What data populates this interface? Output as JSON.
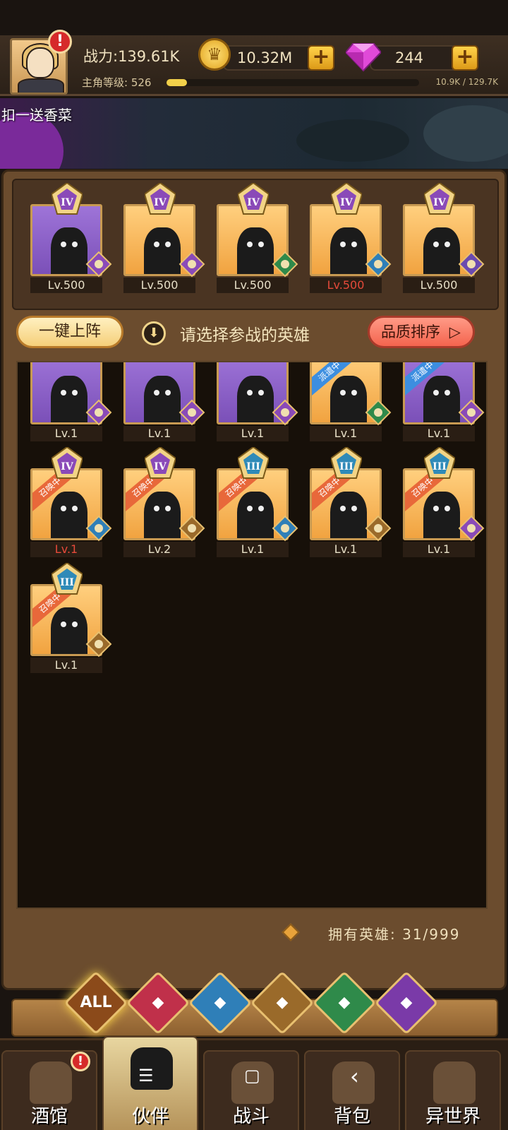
{
  "header": {
    "power_label": "战力:139.61K",
    "level_label": "主角等级: 526",
    "level_progress": 0.08,
    "exp_text": "10.9K / 129.7K",
    "gold": "10.32M",
    "gems": "244",
    "plus": "+",
    "alert": "!"
  },
  "scene": {
    "text": "扣一送香菜"
  },
  "team": [
    {
      "rank": "IV",
      "level": "Lv.500",
      "faction": "demon",
      "bg": "purple"
    },
    {
      "rank": "IV",
      "level": "Lv.500",
      "faction": "demon",
      "bg": "orange"
    },
    {
      "rank": "IV",
      "level": "Lv.500",
      "faction": "elf",
      "bg": "orange"
    },
    {
      "rank": "IV",
      "level": "Lv.500",
      "faction": "fish",
      "bg": "orange",
      "red": true
    },
    {
      "rank": "IV",
      "level": "Lv.500",
      "faction": "warrior",
      "bg": "orange"
    }
  ],
  "controls": {
    "quick_deploy": "一键上阵",
    "prompt": "请选择参战的英雄",
    "sort": "品质排序",
    "sort_arrow": "▷",
    "down_arrow": "⬇"
  },
  "roster": [
    {
      "level": "Lv.1",
      "faction": "demon",
      "bg": "purple"
    },
    {
      "level": "Lv.1",
      "faction": "demon",
      "bg": "purple"
    },
    {
      "level": "Lv.1",
      "faction": "demon",
      "bg": "purple"
    },
    {
      "level": "Lv.1",
      "faction": "elf",
      "bg": "orange",
      "ribbon": "派遣中",
      "ribbon_type": "dispatch"
    },
    {
      "level": "Lv.1",
      "faction": "demon",
      "bg": "purple",
      "ribbon": "派遣中",
      "ribbon_type": "dispatch"
    },
    {
      "rank": "IV",
      "level": "Lv.1",
      "faction": "fish",
      "bg": "orange",
      "ribbon": "召唤中",
      "ribbon_type": "summon",
      "red": true
    },
    {
      "rank": "IV",
      "level": "Lv.2",
      "faction": "beast",
      "bg": "orange",
      "ribbon": "召唤中",
      "ribbon_type": "summon"
    },
    {
      "rank": "III",
      "level": "Lv.1",
      "faction": "fish",
      "bg": "orange",
      "ribbon": "召唤中",
      "ribbon_type": "summon"
    },
    {
      "rank": "III",
      "level": "Lv.1",
      "faction": "beast",
      "bg": "orange",
      "ribbon": "召唤中",
      "ribbon_type": "summon"
    },
    {
      "rank": "III",
      "level": "Lv.1",
      "faction": "demon",
      "bg": "orange",
      "ribbon": "召唤中",
      "ribbon_type": "summon"
    },
    {
      "rank": "III",
      "level": "Lv.1",
      "faction": "beast",
      "bg": "orange",
      "ribbon": "召唤中",
      "ribbon_type": "summon"
    }
  ],
  "hero_count": "拥有英雄: 31/999",
  "filters": [
    {
      "label": "ALL",
      "color": "#8b4a1a"
    },
    {
      "label": "",
      "color": "#c0304a"
    },
    {
      "label": "",
      "color": "#2f7fb8"
    },
    {
      "label": "",
      "color": "#9a6a2a"
    },
    {
      "label": "",
      "color": "#2f8a4a"
    },
    {
      "label": "",
      "color": "#7a3aa8"
    }
  ],
  "nav": [
    {
      "label": "酒馆",
      "icon": "tavern-icon",
      "alert": "!"
    },
    {
      "label": "伙伴",
      "icon": "partner-icon",
      "active": true
    },
    {
      "label": "战斗",
      "icon": "battle-icon"
    },
    {
      "label": "背包",
      "icon": "backpack-icon"
    },
    {
      "label": "异世界",
      "icon": "portal-icon"
    }
  ],
  "system_nav": {
    "menu": "☰",
    "home": "▢",
    "back": "‹"
  },
  "faction_colors": {
    "demon": "#8a4ab8",
    "elf": "#2f8a4a",
    "fish": "#2f7fb8",
    "beast": "#9a6a2a",
    "warrior": "#6a4ab0"
  }
}
